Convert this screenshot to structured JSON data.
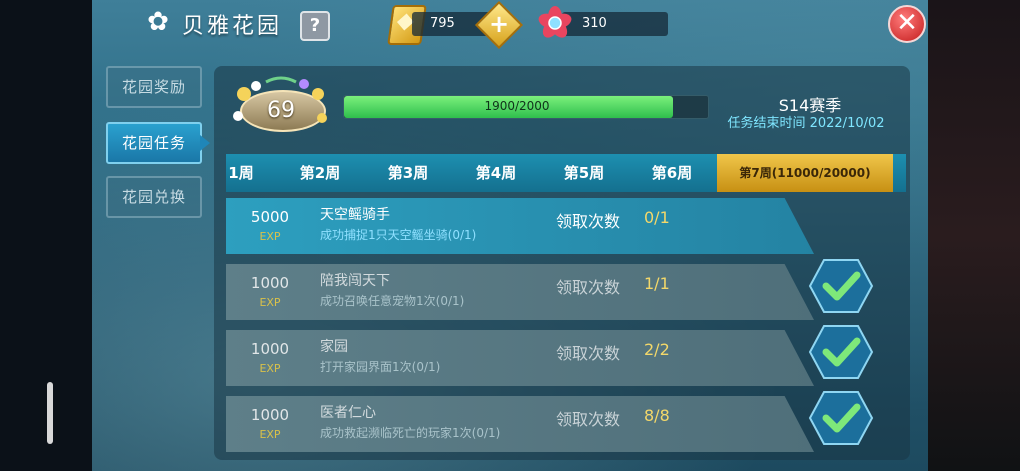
{
  "title": "贝雅花园",
  "help": "?",
  "currency": {
    "gold": "795",
    "flower": "310"
  },
  "close": "✕",
  "nav": [
    {
      "label": "花园奖励"
    },
    {
      "label": "花园任务",
      "active": true
    },
    {
      "label": "花园兑换"
    }
  ],
  "level": "69",
  "progress": {
    "text": "1900/2000",
    "current": 1900,
    "max": 2000
  },
  "season": {
    "name": "S14赛季",
    "deadline": "任务结束时间  2022/10/02"
  },
  "tabs": [
    {
      "label": "1周"
    },
    {
      "label": "第2周"
    },
    {
      "label": "第3周"
    },
    {
      "label": "第4周"
    },
    {
      "label": "第5周"
    },
    {
      "label": "第6周"
    },
    {
      "label": "第7周(11000/20000)",
      "active": true
    }
  ],
  "tasks": [
    {
      "reward": "5000",
      "unit": "EXP",
      "name": "天空鳐骑手",
      "desc": "成功捕捉1只天空鳐坐骑(0/1)",
      "claim_label": "领取次数",
      "claim_count": "0/1",
      "done": false
    },
    {
      "reward": "1000",
      "unit": "EXP",
      "name": "陪我闯天下",
      "desc": "成功召唤任意宠物1次(0/1)",
      "claim_label": "领取次数",
      "claim_count": "1/1",
      "done": true
    },
    {
      "reward": "1000",
      "unit": "EXP",
      "name": "家园",
      "desc": "打开家园界面1次(0/1)",
      "claim_label": "领取次数",
      "claim_count": "2/2",
      "done": true
    },
    {
      "reward": "1000",
      "unit": "EXP",
      "name": "医者仁心",
      "desc": "成功救起濒临死亡的玩家1次(0/1)",
      "claim_label": "领取次数",
      "claim_count": "8/8",
      "done": true
    }
  ],
  "colors": {
    "accent": "#1f86b8",
    "gold": "#f0c64a",
    "check": "#7ee87a"
  }
}
